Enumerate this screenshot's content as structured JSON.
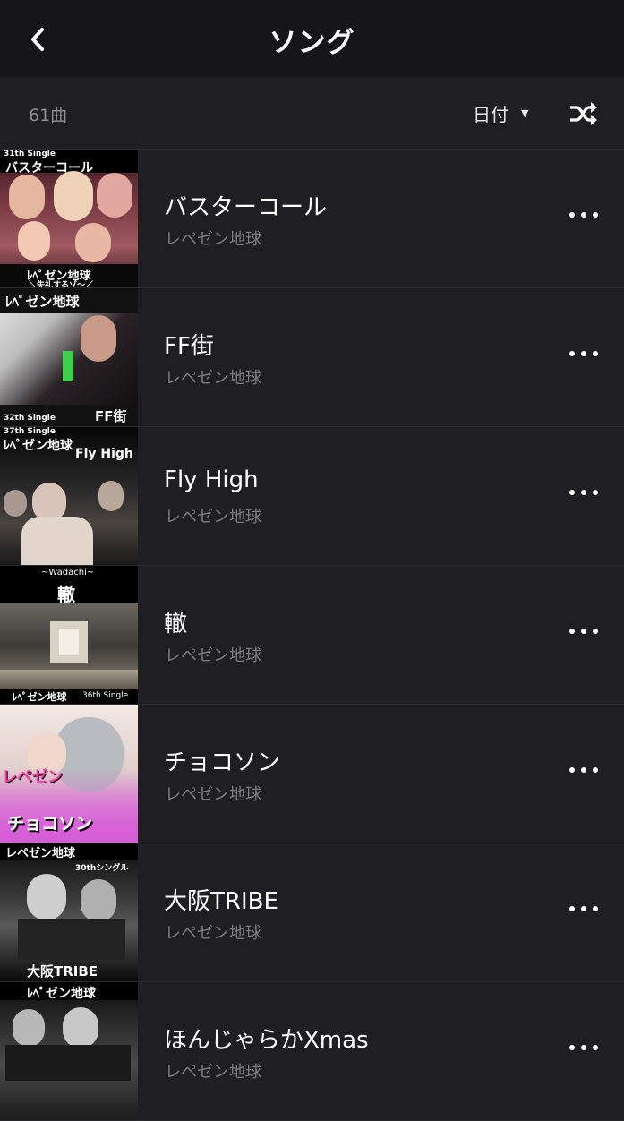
{
  "header": {
    "back_icon": "chevron-left-icon",
    "title": "ソング"
  },
  "toolbar": {
    "count": "61曲",
    "sort_label": "日付",
    "sort_icon": "caret-down-icon",
    "shuffle_icon": "shuffle-icon"
  },
  "songs": [
    {
      "title": "バスターコール",
      "artist": "レペゼン地球",
      "art_lines": [
        "31th Single",
        "バスターコール",
        "ﾚﾍﾟゼン地球",
        "＼失礼するゾ～／"
      ]
    },
    {
      "title": "FF街",
      "artist": "レペゼン地球",
      "art_lines": [
        "ﾚﾍﾟゼン地球",
        "32th Single",
        "FF街"
      ]
    },
    {
      "title": "Fly High",
      "artist": "レペゼン地球",
      "art_lines": [
        "37th Single",
        "ﾚﾍﾟゼン地球",
        "Fly High"
      ]
    },
    {
      "title": "轍",
      "artist": "レペゼン地球",
      "art_lines": [
        "~Wadachi~",
        "轍",
        "ﾚﾍﾟゼン地球",
        "36th Single"
      ]
    },
    {
      "title": "チョコソン",
      "artist": "レペゼン地球",
      "art_lines": [
        "レペゼン",
        "チョコソン"
      ]
    },
    {
      "title": "大阪TRIBE",
      "artist": "レペゼン地球",
      "art_lines": [
        "レペゼン地球",
        "30thシングル",
        "大阪TRIBE"
      ]
    },
    {
      "title": "ほんじゃらかXmas",
      "artist": "レペゼン地球",
      "art_lines": [
        "ﾚﾍﾟゼン地球"
      ]
    }
  ],
  "more_icon": "more-horizontal-icon",
  "colors": {
    "background": "#1f1f23",
    "header": "#161619",
    "text_primary": "#ffffff",
    "text_secondary": "#7c7c82"
  }
}
